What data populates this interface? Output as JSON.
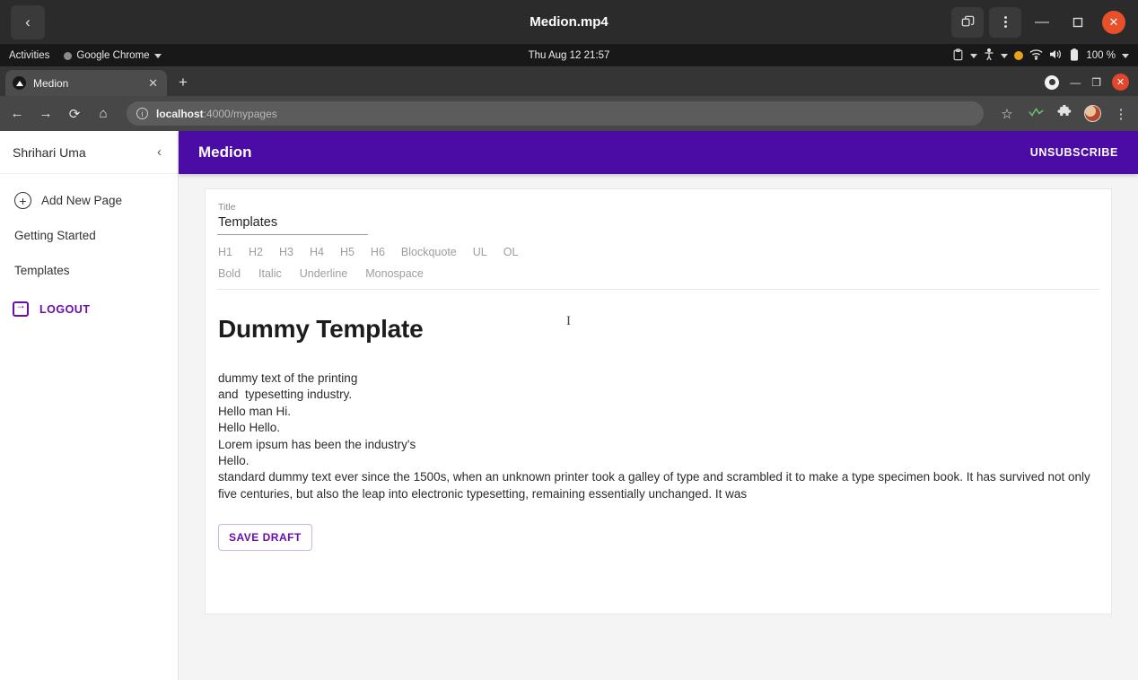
{
  "window": {
    "title": "Medion.mp4",
    "back_icon": "‹",
    "restore_icon": "restore-window-icon",
    "menu_icon": "overflow-menu-icon",
    "minimize_icon": "—",
    "maximize_icon": "▢",
    "close_icon": "✕"
  },
  "gnome": {
    "activities": "Activities",
    "app_name": "Google Chrome",
    "clock": "Thu Aug 12  21:57",
    "battery": "100 %"
  },
  "chrome": {
    "tab_title": "Medion",
    "tab_close": "✕",
    "new_tab": "+",
    "url_prefix": "localhost",
    "url_suffix": ":4000/mypages",
    "back_icon": "←",
    "forward_icon": "→",
    "reload_icon": "⟳",
    "home_icon": "⌂",
    "bookmark_icon": "☆",
    "extensions_icon": "🧩",
    "menu_icon": "⋮",
    "min_icon": "—",
    "max_icon": "❐",
    "close_icon": "✕"
  },
  "sidebar": {
    "user": "Shrihari Uma",
    "collapse_icon": "‹",
    "items": [
      {
        "label": "Add New Page",
        "icon": "plus-circle-icon"
      },
      {
        "label": "Getting Started",
        "icon": ""
      },
      {
        "label": "Templates",
        "icon": ""
      }
    ],
    "logout": "LOGOUT"
  },
  "appbar": {
    "title": "Medion",
    "action": "UNSUBSCRIBE",
    "color": "#4b0ba5"
  },
  "editor": {
    "title_label": "Title",
    "title_value": "Templates",
    "title_placeholder": "Title",
    "format_row_1": [
      "H1",
      "H2",
      "H3",
      "H4",
      "H5",
      "H6",
      "Blockquote",
      "UL",
      "OL"
    ],
    "format_row_2": [
      "Bold",
      "Italic",
      "Underline",
      "Monospace"
    ],
    "doc_heading": "Dummy Template",
    "doc_body": "dummy text of the printing\nand  typesetting industry.\nHello man Hi.\nHello Hello.\nLorem ipsum has been the industry's\nHello.\nstandard dummy text ever since the 1500s, when an unknown printer took a galley of type and scrambled it to make a type specimen book. It has survived not only five centuries, but also the leap into electronic typesetting, remaining essentially unchanged. It was",
    "save_button": "SAVE DRAFT",
    "accent_color": "#6a0dad"
  }
}
